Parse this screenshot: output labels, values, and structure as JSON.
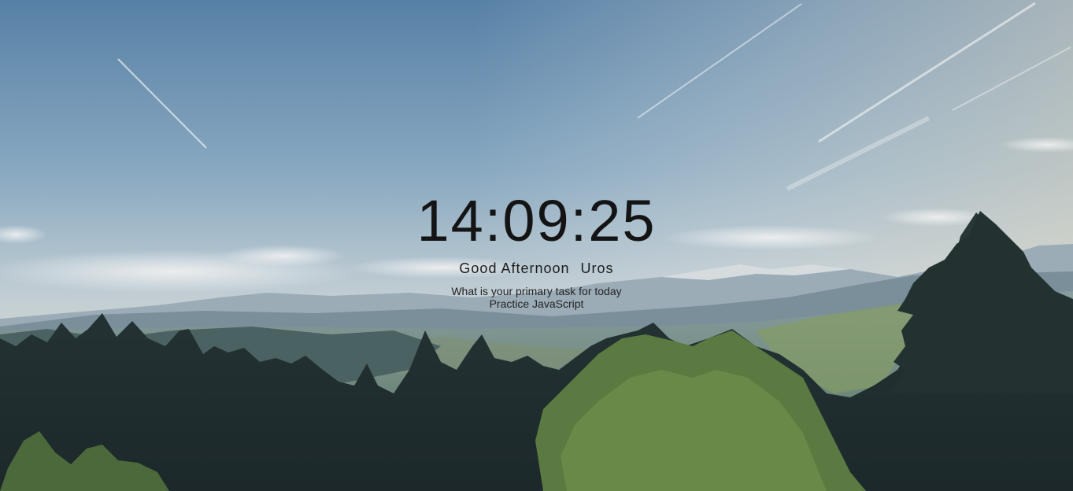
{
  "clock": {
    "time": "14:09:25"
  },
  "greeting": {
    "text": "Good Afternoon",
    "name": "Uros"
  },
  "focus": {
    "question": "What is your primary task for today",
    "value": "Practice JavaScript"
  }
}
